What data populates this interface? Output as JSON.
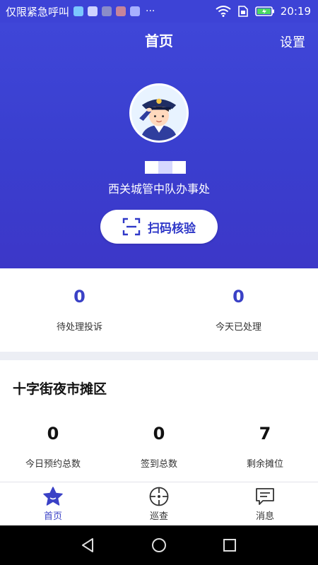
{
  "status_bar": {
    "carrier_text": "仅限紧急呼叫",
    "more": "···",
    "time": "20:19"
  },
  "header": {
    "title": "首页",
    "settings_label": "设置",
    "office_name": "西关城管中队办事处",
    "scan_button_label": "扫码核验"
  },
  "stats": {
    "pending_complaints_value": "0",
    "pending_complaints_label": "待处理投诉",
    "handled_today_value": "0",
    "handled_today_label": "今天已处理"
  },
  "market": {
    "title": "十字街夜市摊区",
    "items": [
      {
        "value": "0",
        "label": "今日预约总数"
      },
      {
        "value": "0",
        "label": "签到总数"
      },
      {
        "value": "7",
        "label": "剩余摊位"
      }
    ]
  },
  "tabbar": {
    "tabs": [
      {
        "label": "首页",
        "icon": "home-star-icon",
        "active": true
      },
      {
        "label": "巡查",
        "icon": "patrol-target-icon",
        "active": false
      },
      {
        "label": "消息",
        "icon": "message-icon",
        "active": false
      }
    ]
  },
  "colors": {
    "brand_blue": "#3d43d6",
    "accent_text": "#3a41c6"
  }
}
